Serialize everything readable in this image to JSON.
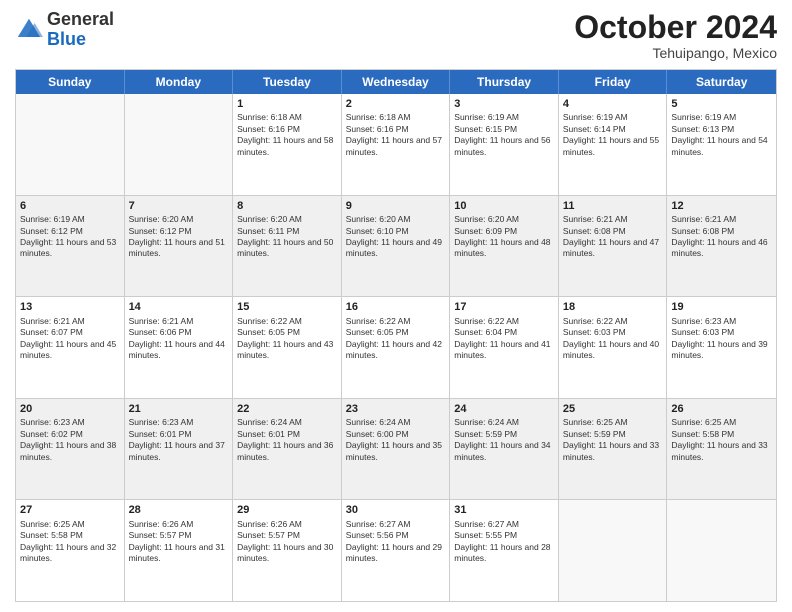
{
  "logo": {
    "general": "General",
    "blue": "Blue"
  },
  "header": {
    "month": "October 2024",
    "location": "Tehuipango, Mexico"
  },
  "weekdays": [
    "Sunday",
    "Monday",
    "Tuesday",
    "Wednesday",
    "Thursday",
    "Friday",
    "Saturday"
  ],
  "rows": [
    [
      {
        "day": "",
        "empty": true
      },
      {
        "day": "",
        "empty": true
      },
      {
        "day": "1",
        "sunrise": "Sunrise: 6:18 AM",
        "sunset": "Sunset: 6:16 PM",
        "daylight": "Daylight: 11 hours and 58 minutes."
      },
      {
        "day": "2",
        "sunrise": "Sunrise: 6:18 AM",
        "sunset": "Sunset: 6:16 PM",
        "daylight": "Daylight: 11 hours and 57 minutes."
      },
      {
        "day": "3",
        "sunrise": "Sunrise: 6:19 AM",
        "sunset": "Sunset: 6:15 PM",
        "daylight": "Daylight: 11 hours and 56 minutes."
      },
      {
        "day": "4",
        "sunrise": "Sunrise: 6:19 AM",
        "sunset": "Sunset: 6:14 PM",
        "daylight": "Daylight: 11 hours and 55 minutes."
      },
      {
        "day": "5",
        "sunrise": "Sunrise: 6:19 AM",
        "sunset": "Sunset: 6:13 PM",
        "daylight": "Daylight: 11 hours and 54 minutes."
      }
    ],
    [
      {
        "day": "6",
        "sunrise": "Sunrise: 6:19 AM",
        "sunset": "Sunset: 6:12 PM",
        "daylight": "Daylight: 11 hours and 53 minutes."
      },
      {
        "day": "7",
        "sunrise": "Sunrise: 6:20 AM",
        "sunset": "Sunset: 6:12 PM",
        "daylight": "Daylight: 11 hours and 51 minutes."
      },
      {
        "day": "8",
        "sunrise": "Sunrise: 6:20 AM",
        "sunset": "Sunset: 6:11 PM",
        "daylight": "Daylight: 11 hours and 50 minutes."
      },
      {
        "day": "9",
        "sunrise": "Sunrise: 6:20 AM",
        "sunset": "Sunset: 6:10 PM",
        "daylight": "Daylight: 11 hours and 49 minutes."
      },
      {
        "day": "10",
        "sunrise": "Sunrise: 6:20 AM",
        "sunset": "Sunset: 6:09 PM",
        "daylight": "Daylight: 11 hours and 48 minutes."
      },
      {
        "day": "11",
        "sunrise": "Sunrise: 6:21 AM",
        "sunset": "Sunset: 6:08 PM",
        "daylight": "Daylight: 11 hours and 47 minutes."
      },
      {
        "day": "12",
        "sunrise": "Sunrise: 6:21 AM",
        "sunset": "Sunset: 6:08 PM",
        "daylight": "Daylight: 11 hours and 46 minutes."
      }
    ],
    [
      {
        "day": "13",
        "sunrise": "Sunrise: 6:21 AM",
        "sunset": "Sunset: 6:07 PM",
        "daylight": "Daylight: 11 hours and 45 minutes."
      },
      {
        "day": "14",
        "sunrise": "Sunrise: 6:21 AM",
        "sunset": "Sunset: 6:06 PM",
        "daylight": "Daylight: 11 hours and 44 minutes."
      },
      {
        "day": "15",
        "sunrise": "Sunrise: 6:22 AM",
        "sunset": "Sunset: 6:05 PM",
        "daylight": "Daylight: 11 hours and 43 minutes."
      },
      {
        "day": "16",
        "sunrise": "Sunrise: 6:22 AM",
        "sunset": "Sunset: 6:05 PM",
        "daylight": "Daylight: 11 hours and 42 minutes."
      },
      {
        "day": "17",
        "sunrise": "Sunrise: 6:22 AM",
        "sunset": "Sunset: 6:04 PM",
        "daylight": "Daylight: 11 hours and 41 minutes."
      },
      {
        "day": "18",
        "sunrise": "Sunrise: 6:22 AM",
        "sunset": "Sunset: 6:03 PM",
        "daylight": "Daylight: 11 hours and 40 minutes."
      },
      {
        "day": "19",
        "sunrise": "Sunrise: 6:23 AM",
        "sunset": "Sunset: 6:03 PM",
        "daylight": "Daylight: 11 hours and 39 minutes."
      }
    ],
    [
      {
        "day": "20",
        "sunrise": "Sunrise: 6:23 AM",
        "sunset": "Sunset: 6:02 PM",
        "daylight": "Daylight: 11 hours and 38 minutes."
      },
      {
        "day": "21",
        "sunrise": "Sunrise: 6:23 AM",
        "sunset": "Sunset: 6:01 PM",
        "daylight": "Daylight: 11 hours and 37 minutes."
      },
      {
        "day": "22",
        "sunrise": "Sunrise: 6:24 AM",
        "sunset": "Sunset: 6:01 PM",
        "daylight": "Daylight: 11 hours and 36 minutes."
      },
      {
        "day": "23",
        "sunrise": "Sunrise: 6:24 AM",
        "sunset": "Sunset: 6:00 PM",
        "daylight": "Daylight: 11 hours and 35 minutes."
      },
      {
        "day": "24",
        "sunrise": "Sunrise: 6:24 AM",
        "sunset": "Sunset: 5:59 PM",
        "daylight": "Daylight: 11 hours and 34 minutes."
      },
      {
        "day": "25",
        "sunrise": "Sunrise: 6:25 AM",
        "sunset": "Sunset: 5:59 PM",
        "daylight": "Daylight: 11 hours and 33 minutes."
      },
      {
        "day": "26",
        "sunrise": "Sunrise: 6:25 AM",
        "sunset": "Sunset: 5:58 PM",
        "daylight": "Daylight: 11 hours and 33 minutes."
      }
    ],
    [
      {
        "day": "27",
        "sunrise": "Sunrise: 6:25 AM",
        "sunset": "Sunset: 5:58 PM",
        "daylight": "Daylight: 11 hours and 32 minutes."
      },
      {
        "day": "28",
        "sunrise": "Sunrise: 6:26 AM",
        "sunset": "Sunset: 5:57 PM",
        "daylight": "Daylight: 11 hours and 31 minutes."
      },
      {
        "day": "29",
        "sunrise": "Sunrise: 6:26 AM",
        "sunset": "Sunset: 5:57 PM",
        "daylight": "Daylight: 11 hours and 30 minutes."
      },
      {
        "day": "30",
        "sunrise": "Sunrise: 6:27 AM",
        "sunset": "Sunset: 5:56 PM",
        "daylight": "Daylight: 11 hours and 29 minutes."
      },
      {
        "day": "31",
        "sunrise": "Sunrise: 6:27 AM",
        "sunset": "Sunset: 5:55 PM",
        "daylight": "Daylight: 11 hours and 28 minutes."
      },
      {
        "day": "",
        "empty": true
      },
      {
        "day": "",
        "empty": true
      }
    ]
  ]
}
